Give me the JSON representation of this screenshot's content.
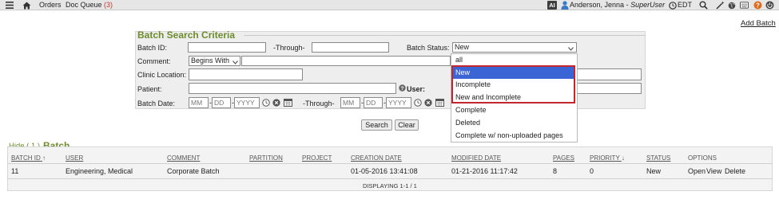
{
  "topbar": {
    "nav_orders": "Orders",
    "nav_doc_queue": "Doc Queue",
    "doc_queue_count": "(3)",
    "ai_badge": "AI",
    "user_name": "Anderson, Jenna",
    "user_separator": "-",
    "user_role": "SuperUser",
    "timezone": "EDT"
  },
  "add_batch_link": "Add Batch",
  "criteria": {
    "title": "Batch Search Criteria",
    "batch_id_label": "Batch ID:",
    "through_label": "-Through-",
    "batch_status_label": "Batch Status:",
    "batch_status_selected": "New",
    "comment_label": "Comment:",
    "comment_operator": "Begins With",
    "clinic_location_label": "Clinic Location:",
    "patient_label": "Patient:",
    "user_label": "User:",
    "batch_date_label": "Batch Date:",
    "date_mm": "MM",
    "date_dd": "DD",
    "date_yyyy": "YYYY"
  },
  "status_dropdown": {
    "options": [
      "all",
      "New",
      "Incomplete",
      "New and Incomplete",
      "Complete",
      "Deleted",
      "Complete w/ non-uploaded pages"
    ],
    "highlighted": "New"
  },
  "buttons": {
    "search": "Search",
    "clear": "Clear"
  },
  "results": {
    "hide_link": "Hide ( 1 )",
    "title": "Batch",
    "columns": [
      "BATCH ID",
      "USER",
      "COMMENT",
      "PARTITION",
      "PROJECT",
      "CREATION DATE",
      "MODIFIED DATE",
      "PAGES",
      "PRIORITY",
      "STATUS",
      "OPTIONS"
    ],
    "rows": [
      {
        "batch_id": "11",
        "user": "Engineering, Medical",
        "comment": "Corporate Batch",
        "partition": "",
        "project": "",
        "creation_date": "01-05-2016 13:41:08",
        "modified_date": "01-21-2016 11:17:42",
        "pages": "8",
        "priority": "0",
        "status": "New",
        "options": [
          "Open",
          "View",
          "Delete"
        ]
      }
    ],
    "footer": "DISPLAYING 1-1 / 1"
  },
  "colors": {
    "accent_green": "#6e8c2c",
    "highlight_blue": "#3b64d4",
    "callout_red": "#c1272d",
    "user_icon_blue": "#3a78c8",
    "help_orange": "#e06a1b"
  }
}
